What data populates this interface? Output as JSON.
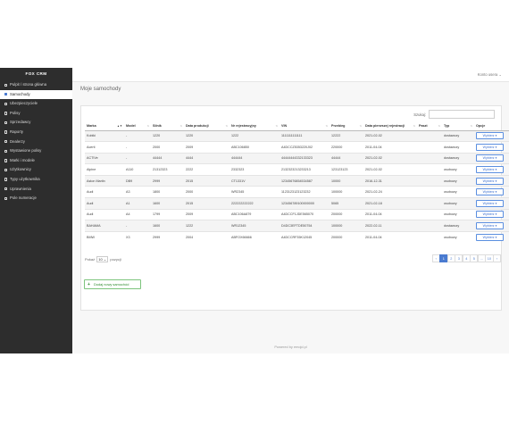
{
  "sidebar": {
    "brand": "FOX CRM",
    "items": [
      {
        "label": "Pulpit / strona główna",
        "icon": "home-icon",
        "active": false
      },
      {
        "label": "Samochody",
        "icon": "car-icon",
        "active": true
      },
      {
        "label": "Ubezpieczyciele",
        "icon": "shield-icon",
        "active": false
      },
      {
        "label": "Polisy",
        "icon": "document-icon",
        "active": false
      },
      {
        "label": "Sprzedawcy",
        "icon": "user-icon",
        "active": false
      },
      {
        "label": "Raporty",
        "icon": "chart-icon",
        "active": false
      },
      {
        "label": "Dealerzy",
        "icon": "building-icon",
        "active": false
      },
      {
        "label": "Wystawione polisy",
        "icon": "file-icon",
        "active": false
      },
      {
        "label": "Marki i modele",
        "icon": "tag-icon",
        "active": false
      },
      {
        "label": "Użytkownicy",
        "icon": "users-icon",
        "active": false
      },
      {
        "label": "Typy użytkownika",
        "icon": "list-icon",
        "active": false
      },
      {
        "label": "Uprawnienia",
        "icon": "key-icon",
        "active": false
      },
      {
        "label": "Pole numeracje",
        "icon": "hash-icon",
        "active": false
      }
    ]
  },
  "topbar": {
    "user_label": "Konto usera ⌄"
  },
  "page": {
    "title": "Moje samochody"
  },
  "search": {
    "label": "Szukaj:",
    "value": ""
  },
  "table": {
    "columns": [
      "Marka",
      "Model",
      "Silnik",
      "Data produkcji",
      "Nr rejestracyjny",
      "VIN",
      "Przebieg",
      "Data pierwszej rejestracji",
      "Paszt",
      "Typ",
      "Opcje"
    ],
    "option_label": "Wybierz ▾",
    "rows": [
      [
        "Kobiki",
        "-",
        "1220",
        "1220",
        "1222",
        "1111111111111",
        "12222",
        "2021-02-02",
        "",
        "dostawczy"
      ],
      [
        "Acerti",
        "-",
        "2000",
        "2009",
        "ABC106850",
        "A4DCCZ5353220J02",
        "220000",
        "2011-04-04",
        "",
        "dostawczy"
      ],
      [
        "ACTIVe",
        "-",
        "44444",
        "4444",
        "444444",
        "44444444332133323",
        "44444",
        "2021-02-02",
        "",
        "dostawczy"
      ],
      [
        "Alpine",
        "A110",
        "21312323",
        "2222",
        "2332323",
        "2132323213233213",
        "123123123",
        "2021-02-02",
        "",
        "osobowy"
      ],
      [
        "Aston Martin",
        "DB9",
        "2999",
        "2015",
        "CT1331V",
        "12345676854534587",
        "10000",
        "2016-12-31",
        "",
        "osobowy"
      ],
      [
        "Audi",
        "A3",
        "1800",
        "2000",
        "WR2345",
        "1123123123123232",
        "100000",
        "2021-02-24",
        "",
        "osobowy"
      ],
      [
        "Audi",
        "A1",
        "1600",
        "2015",
        "222222222222",
        "123456789100000000",
        "5065",
        "2021-02-18",
        "",
        "osobowy"
      ],
      [
        "Audi",
        "A4",
        "1799",
        "2009",
        "ABC106A879",
        "A4DCCF1JDE565070",
        "200000",
        "2011-04-04",
        "",
        "osobowy"
      ],
      [
        "BAHAMA",
        "-",
        "1600",
        "1222",
        "WR12345",
        "D4DC3EFTDE50754",
        "100000",
        "2022-02-11",
        "",
        "dostawczy"
      ],
      [
        "BMW",
        "X3",
        "2999",
        "2004",
        "ABFOX66666",
        "A4DCCRF35K12045",
        "200000",
        "2011-04-04",
        "",
        "osobowy"
      ]
    ]
  },
  "length_menu": {
    "prefix": "Pokaż",
    "value": "10 ⌄",
    "suffix": "pozycji"
  },
  "pagination": [
    "‹",
    "1",
    "2",
    "3",
    "4",
    "5",
    "...",
    "10",
    "›"
  ],
  "add_button": {
    "label": "Dodaj nowy samochód"
  },
  "footer": {
    "text": "Powered by emojd.pl"
  }
}
